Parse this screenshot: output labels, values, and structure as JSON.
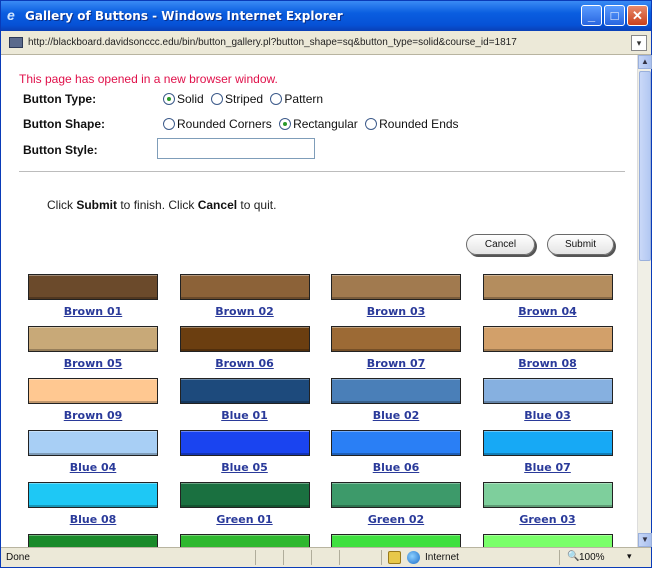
{
  "window": {
    "title": "Gallery of Buttons - Windows Internet Explorer",
    "controls": {
      "minimize": "_",
      "maximize": "□",
      "close": "✕"
    }
  },
  "address": {
    "url": "http://blackboard.davidsonccc.edu/bin/button_gallery.pl?button_shape=sq&button_type=solid&course_id=1817"
  },
  "page": {
    "notice": "This page has opened in a new browser window.",
    "button_type": {
      "label": "Button Type:",
      "options": [
        "Solid",
        "Striped",
        "Pattern"
      ],
      "selected": "Solid"
    },
    "button_shape": {
      "label": "Button Shape:",
      "options": [
        "Rounded Corners",
        "Rectangular",
        "Rounded Ends"
      ],
      "selected": "Rectangular"
    },
    "button_style": {
      "label": "Button Style:",
      "value": ""
    },
    "instruction": {
      "part1": "Click ",
      "submit_word": "Submit",
      "part2": " to finish. Click ",
      "cancel_word": "Cancel",
      "part3": " to quit."
    },
    "cancel_button": "Cancel",
    "submit_button": "Submit"
  },
  "gallery": [
    {
      "name": "Brown 01",
      "color": "#6b4a2b"
    },
    {
      "name": "Brown 02",
      "color": "#8c6238"
    },
    {
      "name": "Brown 03",
      "color": "#a17a4f"
    },
    {
      "name": "Brown 04",
      "color": "#b48d5e"
    },
    {
      "name": "Brown 05",
      "color": "#c8a978"
    },
    {
      "name": "Brown 06",
      "color": "#6b3e10"
    },
    {
      "name": "Brown 07",
      "color": "#9c6a35"
    },
    {
      "name": "Brown 08",
      "color": "#d2a06a"
    },
    {
      "name": "Brown 09",
      "color": "#ffc891"
    },
    {
      "name": "Blue 01",
      "color": "#1d4a7c"
    },
    {
      "name": "Blue 02",
      "color": "#4a7fb8"
    },
    {
      "name": "Blue 03",
      "color": "#86b0e0"
    },
    {
      "name": "Blue 04",
      "color": "#a8cff5"
    },
    {
      "name": "Blue 05",
      "color": "#1a44f0"
    },
    {
      "name": "Blue 06",
      "color": "#2a7ff5"
    },
    {
      "name": "Blue 07",
      "color": "#17a9f5"
    },
    {
      "name": "Blue 08",
      "color": "#1ec8f5"
    },
    {
      "name": "Green 01",
      "color": "#1a7040"
    },
    {
      "name": "Green 02",
      "color": "#3d9a6a"
    },
    {
      "name": "Green 03",
      "color": "#7ecf9c"
    },
    {
      "name": "",
      "color": "#1a8a2a"
    },
    {
      "name": "",
      "color": "#2fb82f"
    },
    {
      "name": "",
      "color": "#3fe03f"
    },
    {
      "name": "",
      "color": "#7aff6a"
    }
  ],
  "status": {
    "left": "Done",
    "zone": "Internet",
    "zoom": "100%"
  }
}
